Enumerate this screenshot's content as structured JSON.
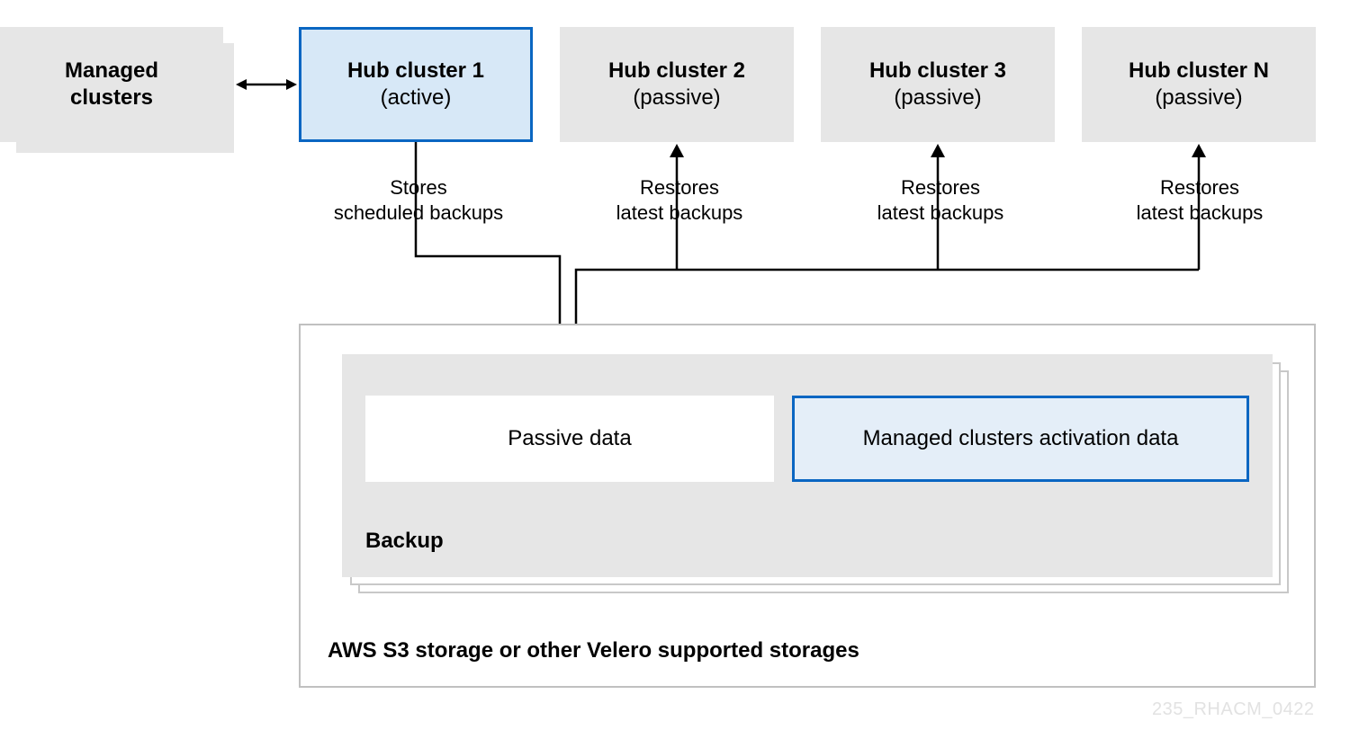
{
  "nodes": {
    "managed": {
      "title": "Managed",
      "sub": "clusters"
    },
    "hub1": {
      "title": "Hub cluster 1",
      "sub": "(active)"
    },
    "hub2": {
      "title": "Hub cluster 2",
      "sub": "(passive)"
    },
    "hub3": {
      "title": "Hub cluster 3",
      "sub": "(passive)"
    },
    "hubN": {
      "title": "Hub cluster N",
      "sub": "(passive)"
    }
  },
  "edges": {
    "e1": {
      "line1": "Stores",
      "line2": "scheduled backups"
    },
    "e2": {
      "line1": "Restores",
      "line2": "latest backups"
    },
    "e3": {
      "line1": "Restores",
      "line2": "latest backups"
    },
    "e4": {
      "line1": "Restores",
      "line2": "latest backups"
    }
  },
  "storage": {
    "caption": "AWS S3 storage or other Velero supported storages",
    "backupLabel": "Backup",
    "passive": "Passive data",
    "activation": "Managed clusters activation data"
  },
  "watermark": "235_RHACM_0422"
}
